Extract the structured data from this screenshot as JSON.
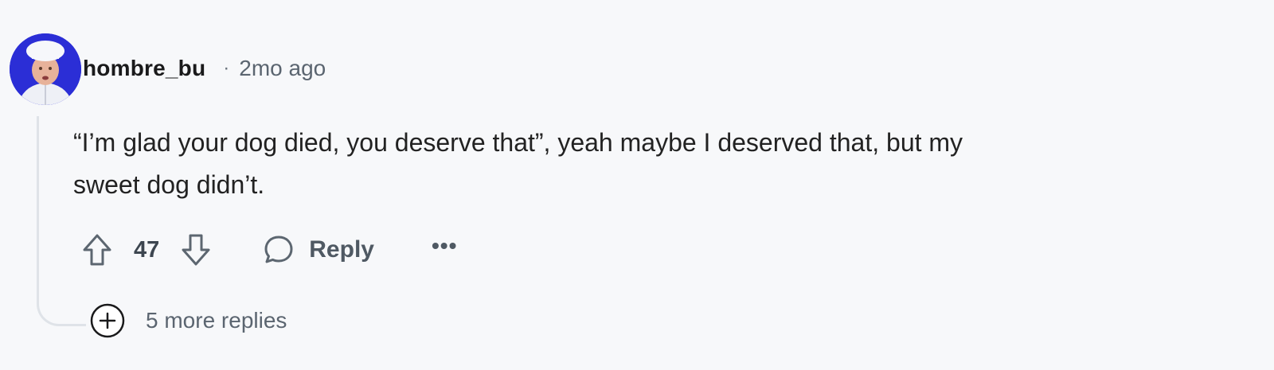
{
  "comment": {
    "author": "hombre_bu",
    "separator": "·",
    "timestamp": "2mo ago",
    "body_lines": [
      "“I’m glad your dog died, you deserve that”, yeah maybe I deserved that, but my",
      "sweet dog didn’t."
    ],
    "score": "47",
    "reply_label": "Reply",
    "more_label": "•••",
    "more_replies_label": "5 more replies"
  },
  "icons": {
    "upvote": "upvote-arrow-icon",
    "downvote": "downvote-arrow-icon",
    "reply": "speech-bubble-icon",
    "more": "ellipsis-icon",
    "expand": "plus-circle-icon"
  },
  "colors": {
    "background": "#f7f8fa",
    "avatar_bg": "#2b2ed6",
    "text_primary": "#1a1a1b",
    "text_muted": "#5b6570",
    "thread_line": "#dfe3e8"
  }
}
